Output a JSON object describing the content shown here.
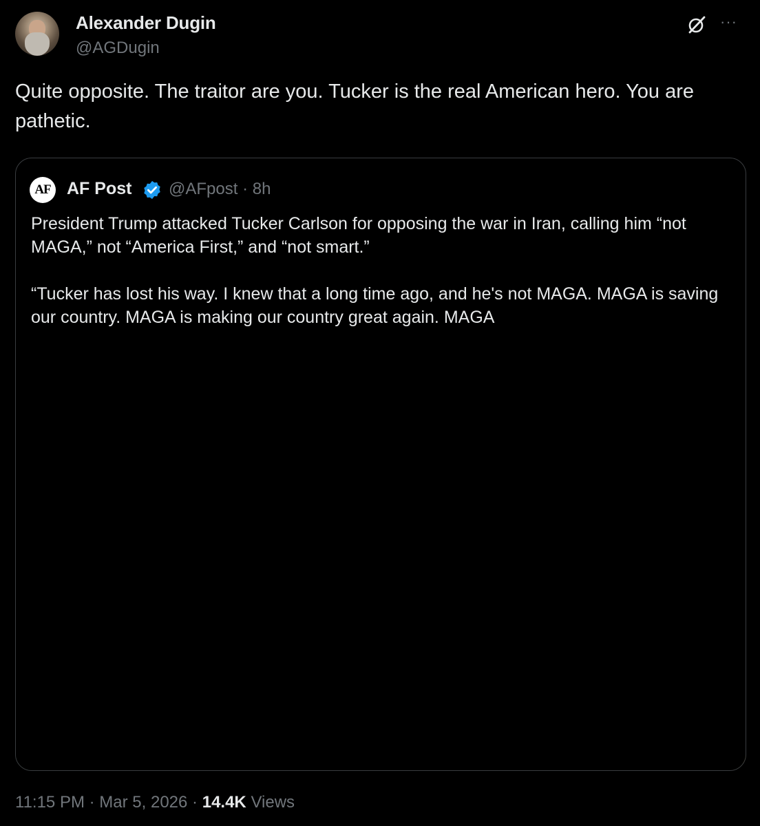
{
  "author": {
    "name": "Alexander Dugin",
    "handle": "@AGDugin"
  },
  "tweet": {
    "text": "Quite opposite. The traitor are you. Tucker is the real American hero. You are pathetic."
  },
  "quoted": {
    "logo_text": "AF",
    "name": "AF Post",
    "handle_time": "@AFpost · 8h",
    "paragraphs": [
      "President Trump attacked Tucker Carlson for opposing the war in Iran, calling him “not MAGA,” not “America First,” and “not smart.”",
      "“Tucker has lost his way. I knew that a long time ago, and he's not MAGA. MAGA is saving our country. MAGA is making our country great again. MAGA"
    ],
    "verified_color": "#1d9bf0"
  },
  "footer": {
    "time": "11:15 PM",
    "date": "Mar 5, 2026",
    "separator": "·",
    "views_count": "14.4K",
    "views_label": "Views"
  },
  "icons": {
    "grok": "grok-icon",
    "more": "more-icon",
    "verified": "verified-badge-icon"
  },
  "colors": {
    "background": "#000000",
    "text_primary": "#e7e9ea",
    "text_secondary": "#71767b",
    "border": "#3a3d40"
  }
}
